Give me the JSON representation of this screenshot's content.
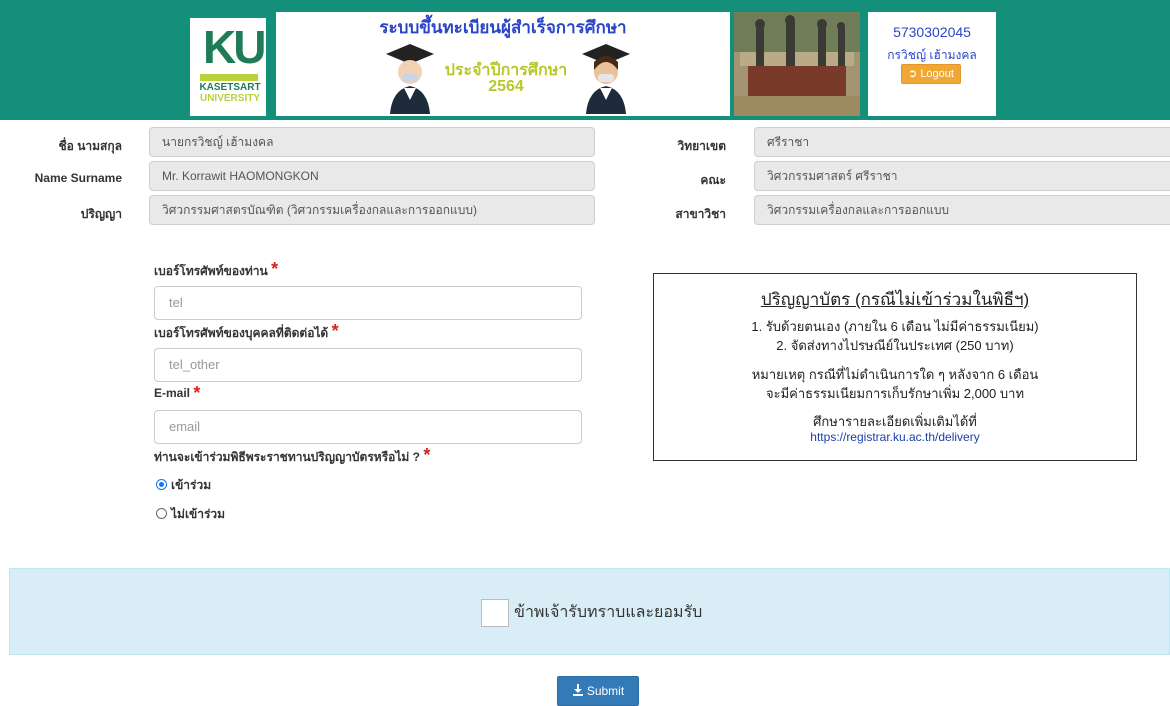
{
  "header": {
    "logo": {
      "main": "KU",
      "line1": "KASETSART",
      "line2": "UNIVERSITY"
    },
    "banner": {
      "title": "ระบบขึ้นทะเบียนผู้สำเร็จการศึกษา",
      "year_label": "ประจำปีการศึกษา",
      "year": "2564"
    },
    "user": {
      "id": "5730302045",
      "name": "กรวิชญ์ เฮ้ามงคล",
      "logout_label": "Logout"
    }
  },
  "profile": {
    "name_th_label": "ชื่อ นามสกุล",
    "name_th": "นายกรวิชญ์ เฮ้ามงคล",
    "name_en_label": "Name Surname",
    "name_en": "Mr. Korrawit  HAOMONGKON",
    "degree_label": "ปริญญา",
    "degree": "วิศวกรรมศาสตรบัณฑิต (วิศวกรรมเครื่องกลและการออกแบบ)",
    "campus_label": "วิทยาเขต",
    "campus": "ศรีราชา",
    "faculty_label": "คณะ",
    "faculty": "วิศวกรรมศาสตร์ ศรีราชา",
    "major_label": "สาขาวิชา",
    "major": "วิศวกรรมเครื่องกลและการออกแบบ"
  },
  "form": {
    "tel_label": "เบอร์โทรศัพท์ของท่าน",
    "tel_placeholder": "tel",
    "tel_other_label": "เบอร์โทรศัพท์ของบุคคลที่ติดต่อได้",
    "tel_other_placeholder": "tel_other",
    "email_label": "E-mail",
    "email_placeholder": "email",
    "ceremony_question": "ท่านจะเข้าร่วมพิธีพระราชทานปริญญาบัตรหรือไม่ ?",
    "required_mark": "*",
    "options": [
      {
        "label": "เข้าร่วม",
        "selected": true
      },
      {
        "label": "ไม่เข้าร่วม",
        "selected": false
      }
    ]
  },
  "notice": {
    "title": "ปริญญาบัตร (กรณีไม่เข้าร่วมในพิธีฯ)",
    "line1": "1. รับด้วยตนเอง (ภายใน 6 เดือน ไม่มีค่าธรรมเนียม)",
    "line2": "2. จัดส่งทางไปรษณีย์ในประเทศ (250 บาท)",
    "note1": "หมายเหตุ กรณีที่ไม่ดำเนินการใด ๆ หลังจาก 6 เดือน",
    "note2": "จะมีค่าธรรมเนียมการเก็บรักษาเพิ่ม 2,000 บาท",
    "more": "ศึกษารายละเอียดเพิ่มเติมได้ที่",
    "link": "https://registrar.ku.ac.th/delivery"
  },
  "agreement": {
    "label": "ข้าพเจ้ารับทราบและยอมรับ",
    "checked": false
  },
  "submit": {
    "label": "Submit"
  },
  "colors": {
    "header": "#148f7a",
    "primary": "#337ab7",
    "warning": "#f0a733",
    "required": "#d9221c",
    "panel": "#d9edf7"
  }
}
